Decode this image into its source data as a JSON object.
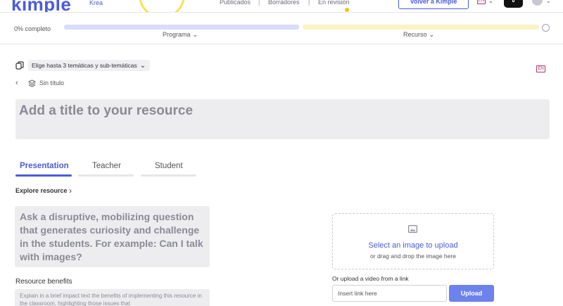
{
  "header": {
    "logo": "kimple",
    "logo_sub": "Krea",
    "nav": {
      "published": "Publicados",
      "drafts": "Borradores",
      "review": "En revisión"
    },
    "back_button": "Volver a Kimple",
    "lang_flag": "EN"
  },
  "progress": {
    "label": "0% completo",
    "segments": {
      "program": "Programa",
      "resource": "Recurso"
    },
    "value": 0
  },
  "topics": {
    "label": "Elige hasta 3 temáticas y sub-temáticas"
  },
  "language_badge": "EN",
  "breadcrumb": {
    "title": "Sin título"
  },
  "title_input": {
    "placeholder": "Add a title to your resource"
  },
  "tabs": {
    "presentation": "Presentation",
    "teacher": "Teacher",
    "student": "Student"
  },
  "explore": "Explore resource",
  "question": {
    "placeholder": "Ask a disruptive, mobilizing question that generates curiosity and challenge in the students. For example: Can I talk with images?"
  },
  "benefits": {
    "label": "Resource benefits",
    "placeholder": "Explain in a brief impact text the benefits of implementing this resource in the classroom, highlighting those issues that"
  },
  "upload": {
    "title": "Select an image to upload",
    "subtitle": "or drag and drop the image here",
    "video_label": "Or upload a video from a link",
    "link_placeholder": "Insert link here",
    "button": "Upload"
  },
  "colors": {
    "brand": "#4b5bdc",
    "accent_yellow": "#f4e25a",
    "button_blue": "#6c82ec"
  }
}
